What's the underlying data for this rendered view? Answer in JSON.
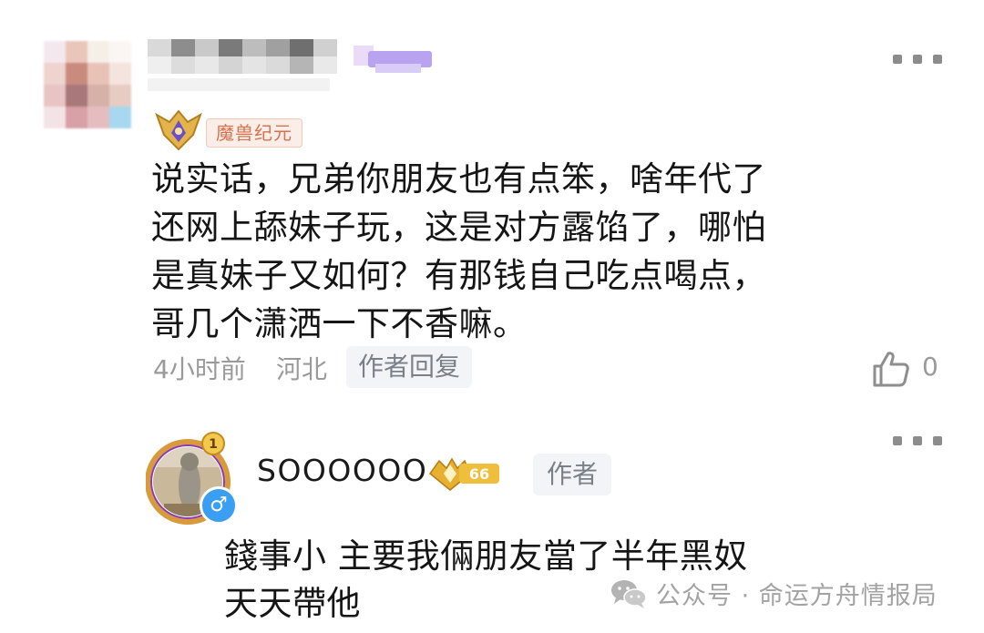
{
  "comments": [
    {
      "medal_title": "魔兽纪元",
      "text": "说实话，兄弟你朋友也有点笨，啥年代了\n还网上舔妹子玩，这是对方露馅了，哪怕\n是真妹子又如何？有那钱自己吃点喝点，\n哥几个潇洒一下不香嘛。",
      "time": "4小时前",
      "region": "河北",
      "reply_label": "作者回复",
      "like_count": "0",
      "icons": [
        "more-icon",
        "medal-icon",
        "like-icon"
      ]
    },
    {
      "username": "SOOOOOO",
      "level": "66",
      "author_tag": "作者",
      "gender": "♂",
      "text": "錢事小 主要我倆朋友當了半年黑奴\n天天帶他",
      "icons": [
        "more-icon",
        "level-badge-icon",
        "gender-male-icon"
      ]
    }
  ],
  "watermark": {
    "text": "公众号 · 命运方舟情报局",
    "icon": "wechat-icon"
  },
  "colors": {
    "meta_gray": "#9a9a9a",
    "chip_bg": "#f3f4f7",
    "gold": "#e0a629",
    "male_blue": "#3a9ef2"
  }
}
